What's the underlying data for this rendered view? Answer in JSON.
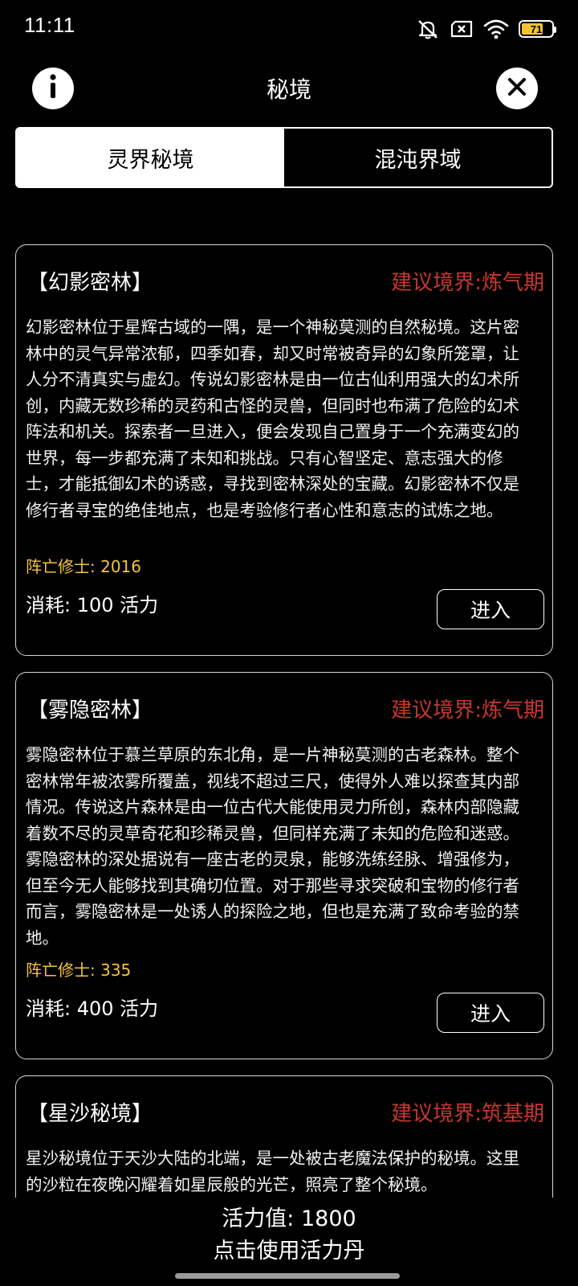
{
  "status_bar": {
    "time": "11:11",
    "battery_level": "71",
    "battery_fraction": 0.71,
    "battery_color": "#f4c430",
    "icons": [
      "bell-muted-icon",
      "sim-x-icon",
      "wifi-icon",
      "battery-icon"
    ]
  },
  "header": {
    "title": "秘境",
    "info_icon": "info-icon",
    "close_icon": "close-icon"
  },
  "tabs": [
    {
      "label": "灵界秘境",
      "active": true
    },
    {
      "label": "混沌界域",
      "active": false
    }
  ],
  "colors": {
    "realm_red": "#c8362f",
    "fallen_yellow": "#f3c43a"
  },
  "realms": [
    {
      "name": "【幻影密林】",
      "recommended": "建议境界:炼气期",
      "description": "幻影密林位于星辉古域的一隅，是一个神秘莫测的自然秘境。这片密林中的灵气异常浓郁，四季如春，却又时常被奇异的幻象所笼罩，让人分不清真实与虚幻。传说幻影密林是由一位古仙利用强大的幻术所创，内藏无数珍稀的灵药和古怪的灵兽，但同时也布满了危险的幻术阵法和机关。探索者一旦进入，便会发现自己置身于一个充满变幻的世界，每一步都充满了未知和挑战。只有心智坚定、意志强大的修士，才能抵御幻术的诱惑，寻找到密林深处的宝藏。幻影密林不仅是修行者寻宝的绝佳地点，也是考验修行者心性和意志的试炼之地。",
      "fallen": "阵亡修士: 2016",
      "cost": "消耗: 100 活力",
      "enter_label": "进入"
    },
    {
      "name": "【雾隐密林】",
      "recommended": "建议境界:炼气期",
      "description": "雾隐密林位于慕兰草原的东北角，是一片神秘莫测的古老森林。整个密林常年被浓雾所覆盖，视线不超过三尺，使得外人难以探查其内部情况。传说这片森林是由一位古代大能使用灵力所创，森林内部隐藏着数不尽的灵草奇花和珍稀灵兽，但同样充满了未知的危险和迷惑。雾隐密林的深处据说有一座古老的灵泉，能够洗练经脉、增强修为，但至今无人能够找到其确切位置。对于那些寻求突破和宝物的修行者而言，雾隐密林是一处诱人的探险之地，但也是充满了致命考验的禁地。",
      "fallen": "阵亡修士: 335",
      "cost": "消耗: 400 活力",
      "enter_label": "进入"
    },
    {
      "name": "【星沙秘境】",
      "recommended": "建议境界:筑基期",
      "description": "星沙秘境位于天沙大陆的北端，是一处被古老魔法保护的秘境。这里的沙粒在夜晚闪耀着如星辰般的光芒，照亮了整个秘境。",
      "fallen": "",
      "cost": "",
      "enter_label": ""
    }
  ],
  "footer": {
    "energy": "活力值: 1800",
    "use_pill": "点击使用活力丹"
  }
}
